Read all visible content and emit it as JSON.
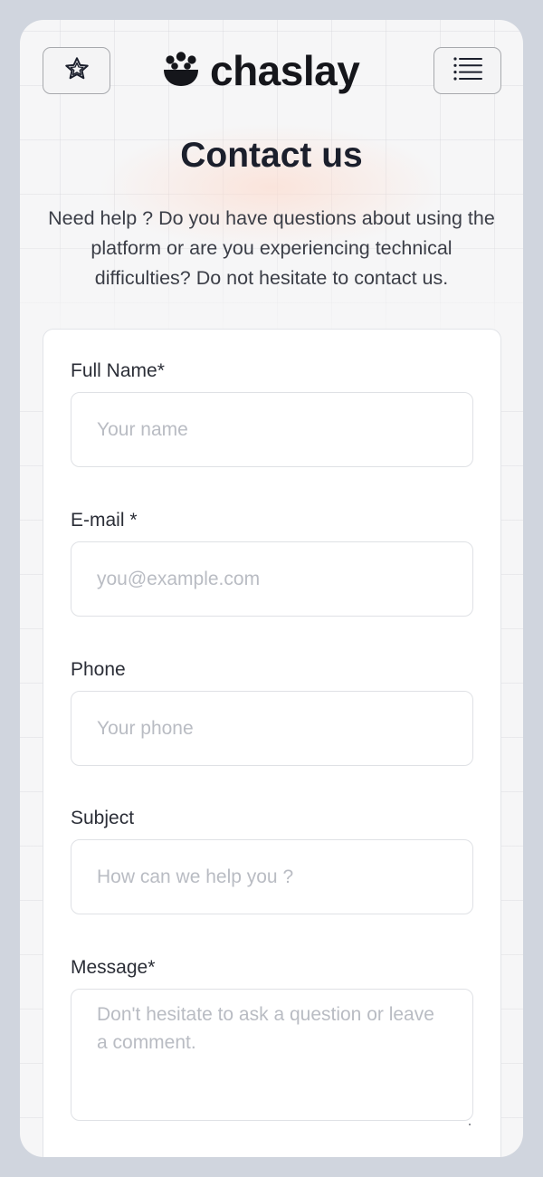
{
  "header": {
    "favorite_icon": "star-icon",
    "menu_icon": "list-icon",
    "logo_text": "chaslay",
    "logo_icon": "bowl-dots-icon"
  },
  "page": {
    "title": "Contact us",
    "intro": "Need help ? Do you have questions about using the platform or are you experiencing technical difficulties? Do not hesitate to contact us."
  },
  "form": {
    "full_name": {
      "label": "Full Name*",
      "placeholder": "Your name",
      "value": ""
    },
    "email": {
      "label": "E-mail *",
      "placeholder": "you@example.com",
      "value": ""
    },
    "phone": {
      "label": "Phone",
      "placeholder": "Your phone",
      "value": ""
    },
    "subject": {
      "label": "Subject",
      "placeholder": "How can we help you ?",
      "value": ""
    },
    "message": {
      "label": "Message*",
      "placeholder": "Don't hesitate to ask a question or leave a comment.",
      "value": ""
    }
  },
  "colors": {
    "frame_border": "#d0d5de",
    "text_dark": "#1b1f2c",
    "placeholder": "#b9bcc3",
    "glow": "#fcded2"
  }
}
